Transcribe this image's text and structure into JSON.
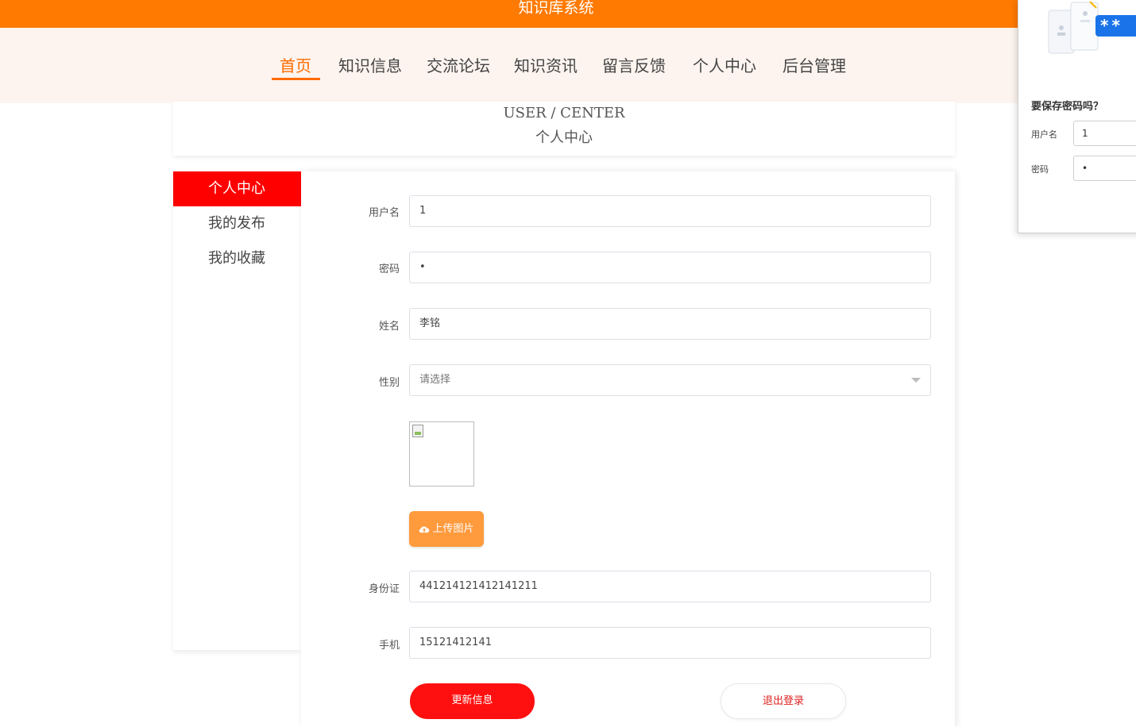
{
  "app": {
    "title": "知识库系统"
  },
  "nav": {
    "items": [
      {
        "label": "首页",
        "active": true
      },
      {
        "label": "知识信息"
      },
      {
        "label": "交流论坛"
      },
      {
        "label": "知识资讯"
      },
      {
        "label": "留言反馈"
      },
      {
        "label": "个人中心"
      },
      {
        "label": "后台管理"
      }
    ]
  },
  "header": {
    "title_en": "USER / CENTER",
    "title_zh": "个人中心"
  },
  "sidebar": {
    "items": [
      {
        "label": "个人中心",
        "active": true
      },
      {
        "label": "我的发布"
      },
      {
        "label": "我的收藏"
      }
    ]
  },
  "form": {
    "username": {
      "label": "用户名",
      "value": "1"
    },
    "password": {
      "label": "密码",
      "value": "•"
    },
    "name": {
      "label": "姓名",
      "value": "李铭"
    },
    "gender": {
      "label": "性别",
      "placeholder": "请选择"
    },
    "upload_label": "上传图片",
    "id_card": {
      "label": "身份证",
      "value": "441214121412141211"
    },
    "phone": {
      "label": "手机",
      "value": "15121412141"
    },
    "update_label": "更新信息",
    "logout_label": "退出登录"
  },
  "password_prompt": {
    "title": "要保存密码吗？",
    "username_label": "用户名",
    "username_value": "1",
    "password_label": "密码",
    "password_value": "•",
    "badge": "**",
    "accent": "#1a73e8"
  },
  "colors": {
    "brand": "#ff7a00",
    "active_nav": "#ff6a00",
    "danger": "#ff1010",
    "upload": "#ff9a3d"
  }
}
